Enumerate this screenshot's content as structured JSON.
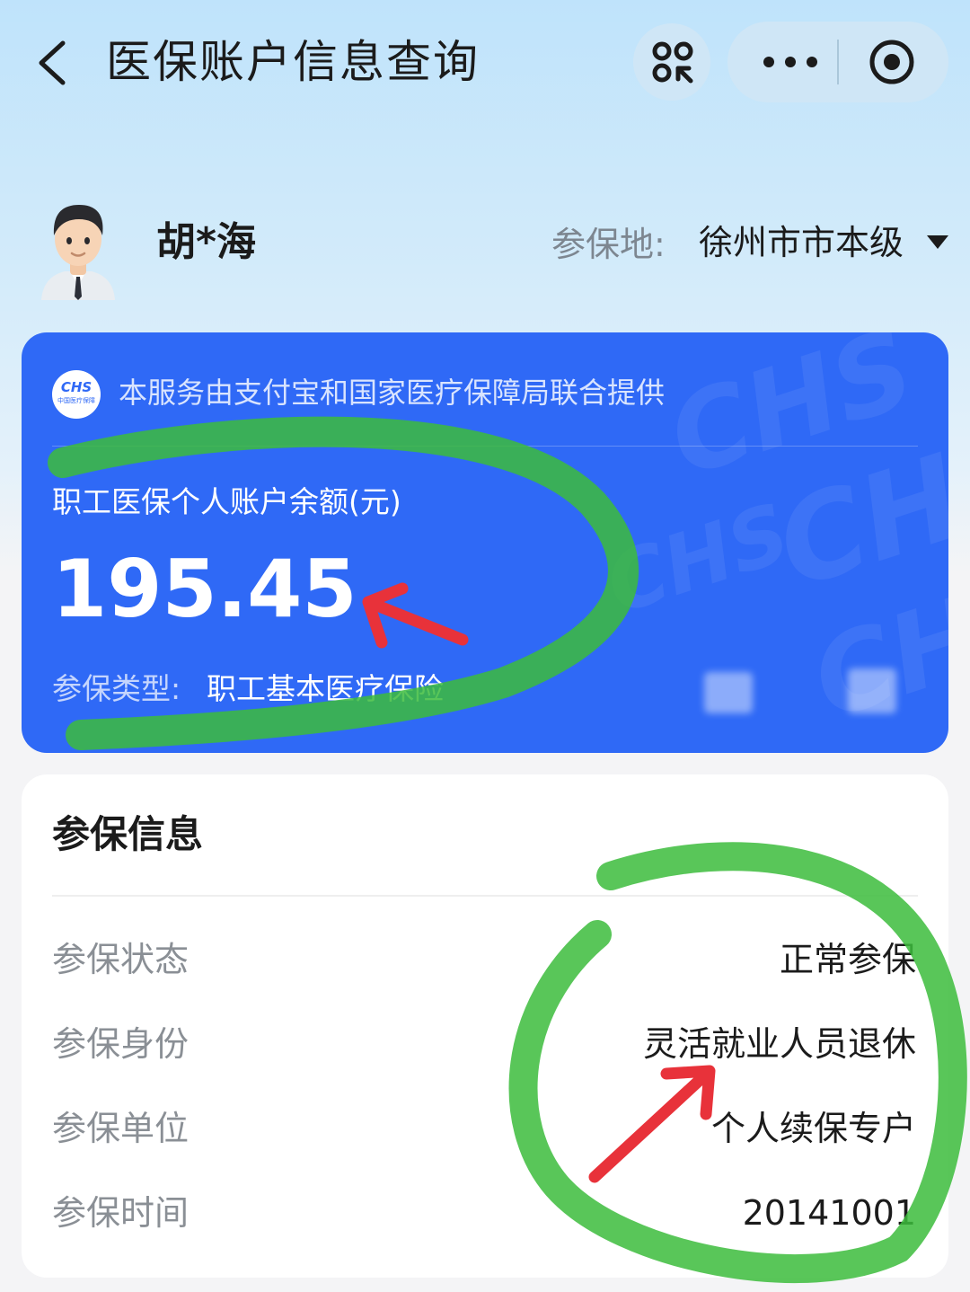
{
  "header": {
    "title": "医保账户信息查询",
    "icons": [
      "chevron-left-icon",
      "scan-icon",
      "more-icon",
      "record-icon"
    ]
  },
  "user": {
    "name": "胡*海",
    "location_label": "参保地:",
    "location_value": "徐州市市本级"
  },
  "account_card": {
    "logo_text": "CHS",
    "logo_subtext": "中国医疗保障",
    "provider_text": "本服务由支付宝和国家医疗保障局联合提供",
    "balance_label": "职工医保个人账户余额(元)",
    "balance_value": "195.45",
    "insurance_type_label": "参保类型:",
    "insurance_type_value": "职工基本医疗保险",
    "watermark_text": "CHS",
    "accent_color": "#2f69f6"
  },
  "insurance_info": {
    "title": "参保信息",
    "rows": [
      {
        "label": "参保状态",
        "value": "正常参保"
      },
      {
        "label": "参保身份",
        "value": "灵活就业人员退休"
      },
      {
        "label": "参保单位",
        "value": "个人续保专户"
      },
      {
        "label": "参保时间",
        "value": "20141001"
      }
    ]
  },
  "annotations": {
    "circle_color": "#3cbc3c",
    "arrow_color": "#e8323a"
  }
}
